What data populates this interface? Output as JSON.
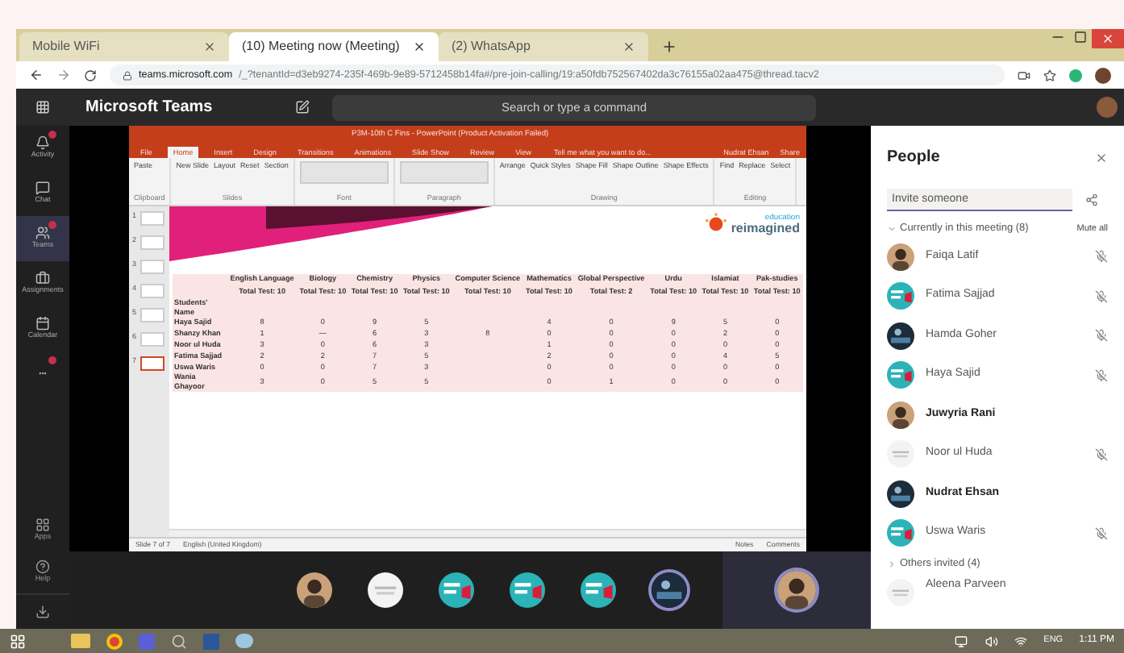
{
  "browser": {
    "tabs": [
      {
        "label": "Mobile WiFi",
        "selected": false
      },
      {
        "label": "(10) Meeting now (Meeting)",
        "selected": true
      },
      {
        "label": "(2) WhatsApp",
        "selected": false
      }
    ],
    "url_host": "teams.microsoft.com",
    "url_path": "/_?tenantId=d3eb9274-235f-469b-9e89-5712458b14fa#/pre-join-calling/19:a50fdb752567402da3c76155a02aa475@thread.tacv2"
  },
  "teams": {
    "title": "Microsoft Teams",
    "search": {
      "placeholder": "Search or type a command"
    },
    "rail": [
      {
        "label": "Activity",
        "selected": false,
        "badge": true
      },
      {
        "label": "Chat",
        "selected": false,
        "badge": false
      },
      {
        "label": "Teams",
        "selected": true,
        "badge": true
      },
      {
        "label": "Assignments",
        "selected": false,
        "badge": false
      },
      {
        "label": "Calendar",
        "selected": false,
        "badge": false
      },
      {
        "label": "•••",
        "selected": false,
        "badge": true
      }
    ],
    "rail_bottom": [
      {
        "label": "Apps"
      },
      {
        "label": "Help"
      }
    ]
  },
  "powerpoint": {
    "title": "P3M-10th C Fins - PowerPoint (Product Activation Failed)",
    "tabs": [
      {
        "label": "File",
        "selected": false
      },
      {
        "label": "Home",
        "selected": true
      },
      {
        "label": "Insert",
        "selected": false
      },
      {
        "label": "Design",
        "selected": false
      },
      {
        "label": "Transitions",
        "selected": false
      },
      {
        "label": "Animations",
        "selected": false
      },
      {
        "label": "Slide Show",
        "selected": false
      },
      {
        "label": "Review",
        "selected": false
      },
      {
        "label": "View",
        "selected": false
      }
    ],
    "tell_me": "Tell me what you want to do...",
    "user": "Nudrat Ehsan",
    "share": "Share",
    "groups": [
      {
        "label": "Clipboard",
        "items": [
          "Paste"
        ]
      },
      {
        "label": "Slides",
        "items": [
          "New Slide",
          "Layout",
          "Reset",
          "Section"
        ]
      },
      {
        "label": "Font"
      },
      {
        "label": "Paragraph"
      },
      {
        "label": "Drawing",
        "items": [
          "Arrange",
          "Quick Styles",
          "Shape Fill",
          "Shape Outline",
          "Shape Effects"
        ]
      },
      {
        "label": "Editing",
        "items": [
          "Find",
          "Replace",
          "Select"
        ]
      }
    ],
    "thumbnails": [
      {
        "number": "1",
        "selected": false
      },
      {
        "number": "2",
        "selected": false
      },
      {
        "number": "3",
        "selected": false
      },
      {
        "number": "4",
        "selected": false
      },
      {
        "number": "5",
        "selected": false
      },
      {
        "number": "6",
        "selected": false
      },
      {
        "number": "7",
        "selected": true
      }
    ],
    "slide": {
      "logo_top": "education",
      "logo_bottom": "reimagined",
      "table": {
        "name_header": "Students' Name",
        "columns": [
          {
            "subject": "English Language",
            "total": "Total Test: 10"
          },
          {
            "subject": "Biology",
            "total": "Total Test: 10"
          },
          {
            "subject": "Chemistry",
            "total": "Total Test: 10"
          },
          {
            "subject": "Physics",
            "total": "Total Test: 10"
          },
          {
            "subject": "Computer Science",
            "total": "Total Test: 10"
          },
          {
            "subject": "Mathematics",
            "total": "Total Test: 10"
          },
          {
            "subject": "Global Perspective",
            "total": "Total Test: 2"
          },
          {
            "subject": "Urdu",
            "total": "Total Test: 10"
          },
          {
            "subject": "Islamiat",
            "total": "Total Test: 10"
          },
          {
            "subject": "Pak-studies",
            "total": "Total Test: 10"
          }
        ],
        "rows": [
          {
            "name": "Haya Sajid",
            "scores": [
              {
                "kind": "score",
                "text": "8"
              },
              {
                "kind": "score",
                "text": "0"
              },
              {
                "kind": "score",
                "text": "9"
              },
              {
                "kind": "score",
                "text": "5"
              },
              {
                "kind": "empty"
              },
              {
                "kind": "score",
                "text": "4"
              },
              {
                "kind": "score",
                "text": "0"
              },
              {
                "kind": "score",
                "text": "9"
              },
              {
                "kind": "score",
                "text": "5"
              },
              {
                "kind": "score",
                "text": "0"
              }
            ]
          },
          {
            "name": "Shanzy Khan",
            "scores": [
              {
                "kind": "score",
                "text": "1"
              },
              {
                "kind": "score",
                "text": "—"
              },
              {
                "kind": "score",
                "text": "6"
              },
              {
                "kind": "score",
                "text": "3"
              },
              {
                "kind": "score",
                "text": "8"
              },
              {
                "kind": "score",
                "text": "0"
              },
              {
                "kind": "score",
                "text": "0"
              },
              {
                "kind": "score",
                "text": "0"
              },
              {
                "kind": "score",
                "text": "2"
              },
              {
                "kind": "score",
                "text": "0"
              }
            ]
          },
          {
            "name": "Noor ul Huda",
            "scores": [
              {
                "kind": "score",
                "text": "3"
              },
              {
                "kind": "score",
                "text": "0"
              },
              {
                "kind": "score",
                "text": "6"
              },
              {
                "kind": "score",
                "text": "3"
              },
              {
                "kind": "empty"
              },
              {
                "kind": "score",
                "text": "1"
              },
              {
                "kind": "score",
                "text": "0"
              },
              {
                "kind": "score",
                "text": "0"
              },
              {
                "kind": "score",
                "text": "0"
              },
              {
                "kind": "score",
                "text": "0"
              }
            ]
          },
          {
            "name": "Fatima Sajjad",
            "scores": [
              {
                "kind": "score",
                "text": "2"
              },
              {
                "kind": "score",
                "text": "2"
              },
              {
                "kind": "score",
                "text": "7"
              },
              {
                "kind": "score",
                "text": "5"
              },
              {
                "kind": "empty"
              },
              {
                "kind": "score",
                "text": "2"
              },
              {
                "kind": "score",
                "text": "0"
              },
              {
                "kind": "score",
                "text": "0"
              },
              {
                "kind": "score",
                "text": "4"
              },
              {
                "kind": "score",
                "text": "5"
              }
            ]
          },
          {
            "name": "Uswa Waris",
            "scores": [
              {
                "kind": "score",
                "text": "0"
              },
              {
                "kind": "score",
                "text": "0"
              },
              {
                "kind": "score",
                "text": "7"
              },
              {
                "kind": "score",
                "text": "3"
              },
              {
                "kind": "empty"
              },
              {
                "kind": "score",
                "text": "0"
              },
              {
                "kind": "score",
                "text": "0"
              },
              {
                "kind": "score",
                "text": "0"
              },
              {
                "kind": "score",
                "text": "0"
              },
              {
                "kind": "score",
                "text": "0"
              }
            ]
          },
          {
            "name": "Wania Ghayoor",
            "scores": [
              {
                "kind": "score",
                "text": "3"
              },
              {
                "kind": "score",
                "text": "0"
              },
              {
                "kind": "score",
                "text": "5"
              },
              {
                "kind": "score",
                "text": "5"
              },
              {
                "kind": "empty"
              },
              {
                "kind": "score",
                "text": "0"
              },
              {
                "kind": "score",
                "text": "1"
              },
              {
                "kind": "score",
                "text": "0"
              },
              {
                "kind": "score",
                "text": "0"
              },
              {
                "kind": "score",
                "text": "0"
              }
            ]
          }
        ]
      }
    },
    "status": {
      "slide_count": "Slide 7 of 7",
      "language": "English (United Kingdom)",
      "notes": "Notes",
      "comments": "Comments"
    }
  },
  "stage_avatars": [
    {
      "kind": "photo"
    },
    {
      "kind": "blank"
    },
    {
      "kind": "teal"
    },
    {
      "kind": "teal"
    },
    {
      "kind": "teal"
    },
    {
      "kind": "dark"
    }
  ],
  "spotlight_avatar": {
    "kind": "photo"
  },
  "people": {
    "title": "People",
    "invite": {
      "placeholder": "Invite someone"
    },
    "current_header": "Currently in this meeting (8)",
    "mute_all": "Mute all",
    "current_expanded": true,
    "participants": [
      {
        "name": "Faiqa Latif",
        "kind": "photo",
        "muted": true
      },
      {
        "name": "Fatima Sajjad",
        "kind": "teal",
        "muted": true
      },
      {
        "name": "Hamda Goher",
        "kind": "dark",
        "muted": true
      },
      {
        "name": "Haya Sajid",
        "kind": "teal",
        "muted": true
      },
      {
        "name": "Juwyria Rani",
        "kind": "photo",
        "muted": false
      },
      {
        "name": "Noor ul Huda",
        "kind": "blank",
        "muted": true
      },
      {
        "name": "Nudrat Ehsan",
        "kind": "dark",
        "muted": false
      },
      {
        "name": "Uswa Waris",
        "kind": "teal",
        "muted": true
      }
    ],
    "invited_header": "Others invited (4)",
    "invited_expanded": false,
    "invited": [
      {
        "name": "Aleena Parveen",
        "kind": "blank"
      }
    ]
  },
  "taskbar": {
    "lang": "ENG",
    "time": "1:11 PM"
  }
}
